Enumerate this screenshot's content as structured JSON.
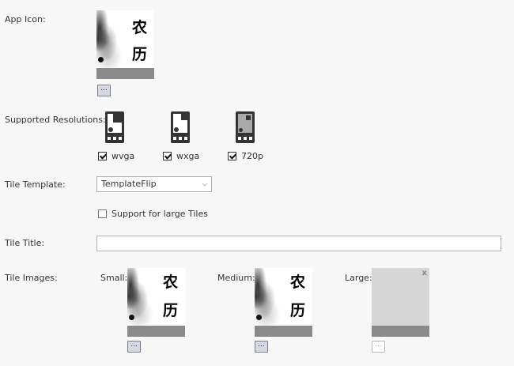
{
  "app_icon": {
    "label": "App Icon:",
    "glyph_top": "农",
    "glyph_bottom": "历",
    "browse_label": "..."
  },
  "resolutions": {
    "label": "Supported Resolutions:",
    "items": [
      {
        "name": "wvga",
        "checked": true
      },
      {
        "name": "wxga",
        "checked": true
      },
      {
        "name": "720p",
        "checked": true
      }
    ]
  },
  "tile_template": {
    "label": "Tile Template:",
    "selected": "TemplateFlip"
  },
  "large_tiles": {
    "label": "Support for large Tiles",
    "checked": false
  },
  "tile_title": {
    "label": "Tile Title:",
    "value": ""
  },
  "tile_images": {
    "label": "Tile Images:",
    "small_label": "Small:",
    "medium_label": "Medium:",
    "large_label": "Large:",
    "close_label": "x",
    "browse_label": "..."
  }
}
